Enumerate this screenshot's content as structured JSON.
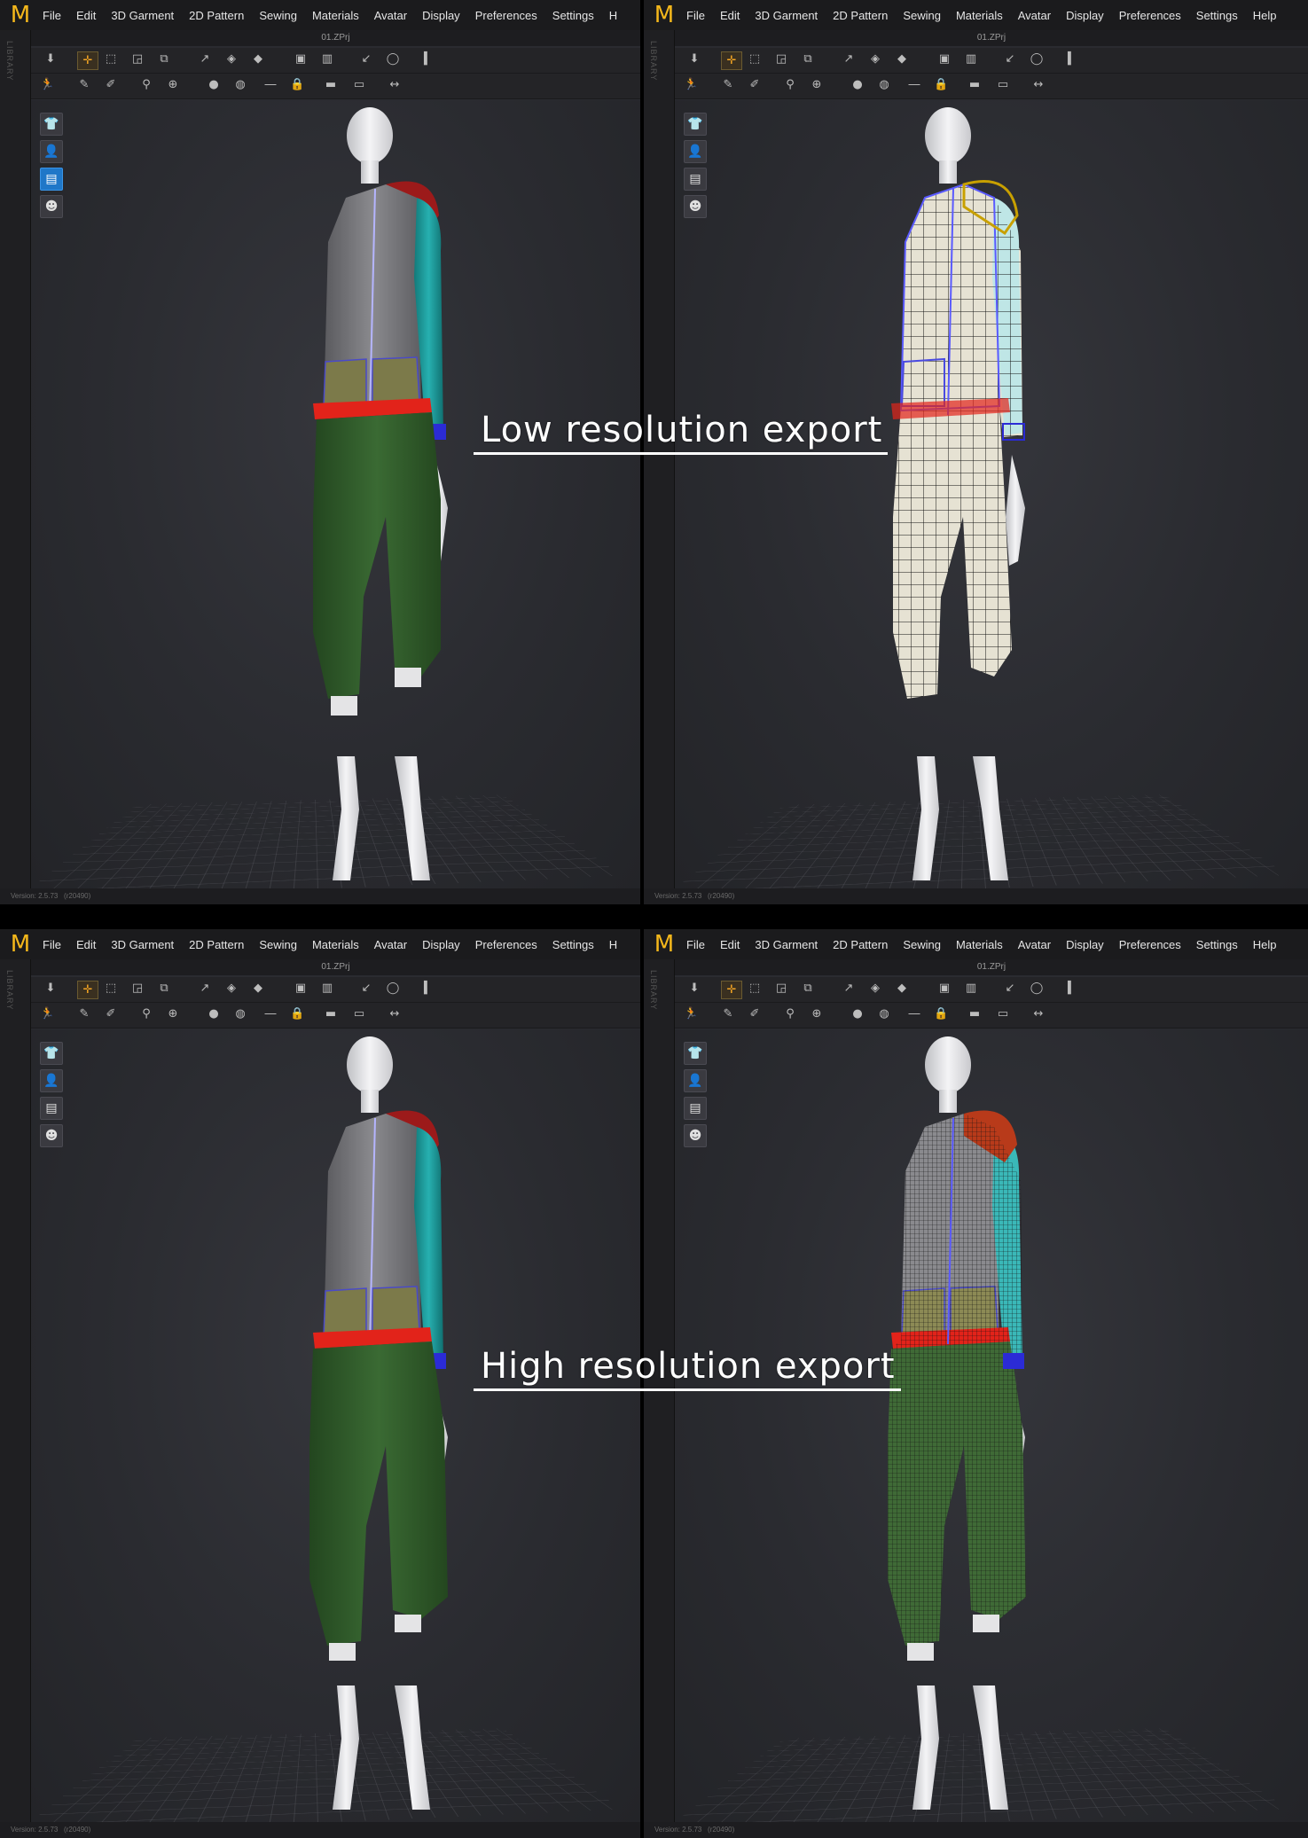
{
  "menu": {
    "logo": "M",
    "items_left": [
      "File",
      "Edit",
      "3D Garment",
      "2D Pattern",
      "Sewing",
      "Materials",
      "Avatar",
      "Display",
      "Preferences",
      "Settings",
      "H"
    ],
    "items_right": [
      "File",
      "Edit",
      "3D Garment",
      "2D Pattern",
      "Sewing",
      "Materials",
      "Avatar",
      "Display",
      "Preferences",
      "Settings",
      "Help"
    ]
  },
  "library_label": "LIBRARY",
  "project_name": "01.ZPrj",
  "status": {
    "version": "Version: 2.5.73",
    "build": "(r20490)"
  },
  "labels": {
    "low": "Low resolution export",
    "high": "High resolution export"
  },
  "colors": {
    "jacket_body": "#6f6f72",
    "jacket_sleeve": "#1e9a9a",
    "pants": "#2f5a2a",
    "waistband": "#e2231a",
    "cuff": "#2b2bd6",
    "hood": "#9c1a1a",
    "pocket": "#7c7a4a",
    "mannequin": "#e8e8ea",
    "active_tool": "#f5a623"
  },
  "panels": [
    {
      "id": "top-left",
      "mode": "solid",
      "resolution": "low"
    },
    {
      "id": "top-right",
      "mode": "wireframe",
      "resolution": "low"
    },
    {
      "id": "bottom-left",
      "mode": "solid",
      "resolution": "high"
    },
    {
      "id": "bottom-right",
      "mode": "wireframe",
      "resolution": "high"
    }
  ]
}
